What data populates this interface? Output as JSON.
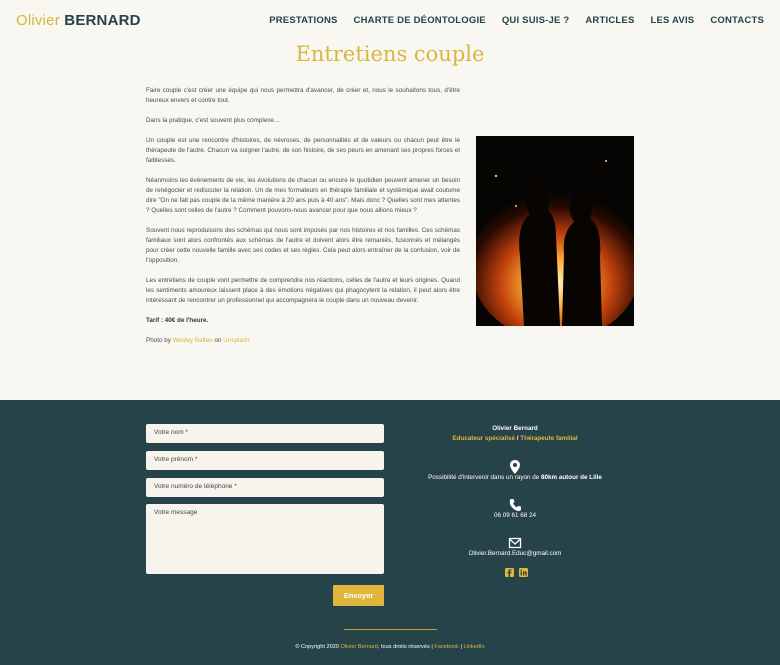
{
  "header": {
    "logo_first": "Olivier",
    "logo_last": "BERNARD",
    "nav": [
      "PRESTATIONS",
      "CHARTE DE DÉONTOLOGIE",
      "QUI SUIS-JE ?",
      "ARTICLES",
      "LES AVIS",
      "CONTACTS"
    ]
  },
  "page": {
    "title": "Entretiens couple",
    "paragraphs": [
      "Faire couple c'est créer une équipe qui nous permettra d'avancer, de créer et, nous le souhaitons tous, d'être heureux envers et contre tout.",
      "Dans la pratique, c'est souvent plus complexe…",
      "Un couple est une rencontre d'histoires, de névroses, de personnalités et de valeurs ou chacun peut être le thérapeute de l'autre. Chacun va soigner l'autre, de son histoire, de ses peurs en amenant ses propres forces et faiblesses.",
      "Néanmoins les évènements de vie, les évolutions de chacun ou encore le quotidien peuvent amener un besoin de renégocier et rediscuter la relation. Un de mes formateurs en thérapie familiale et systémique avait coutume dire \"On ne fait pas couple de la même manière à 20 ans puis à 40 ans\". Mais donc ? Quelles sont mes attentes ? Quelles sont celles de l'autre ? Comment pouvons-nous avancer pour que nous allions mieux ?",
      "Souvent nous reproduisons des schémas qui nous sont imposés par nos histoires et nos familles. Ces schémas familiaux sont alors confrontés aux schémas de l'autre et doivent alors être remaniés, fusionnés et mélangés pour créer cette nouvelle famille avec ses codes et ses règles. Cela peut alors entraîner de la confusion, voir de l'opposition.",
      "Les entretiens de couple vont permettre de comprendre nos réactions, celles de l'autre et leurs origines. Quand les sentiments amoureux laissent place à des émotions négatives qui phagocytent la relation, il peut alors être intéressant de rencontrer un professionnel qui accompagnera le couple dans un nouveau devenir."
    ],
    "price": "Tarif : 40€ de l'heure.",
    "credit_prefix": "Photo by",
    "credit_author": "Wesley Balten",
    "credit_on": "on",
    "credit_site": "Unsplash"
  },
  "form": {
    "name": "Votre nom *",
    "firstname": "Votre prénom *",
    "phone": "Votre numéro de téléphone *",
    "message": "Votre message",
    "send": "Envoyer"
  },
  "contact": {
    "name": "Olivier Bernard",
    "role1": "Educateur spécialisé",
    "sep": "/",
    "role2": "Thérapeute familial",
    "area_prefix": "Possibilité d'intervenir dans un rayon de",
    "area_bold": "80km autour de Lille",
    "phone": "06 09 61 68 24",
    "email": "Olivier.Bernard.Educ@gmail.com"
  },
  "footer": {
    "copy_prefix": "© Copyright 2020",
    "copy_name": "Olivier Bernard",
    "copy_suffix": ", tous droits réservés |",
    "facebook": "Facebook",
    "sep": "|",
    "linkedin": "LinkedIn"
  },
  "colors": {
    "accent": "#d9b63d",
    "dark": "#254348",
    "bg": "#f8f7f2"
  },
  "icons": [
    "map-marker-icon",
    "phone-icon",
    "envelope-icon",
    "facebook-icon",
    "linkedin-icon"
  ]
}
